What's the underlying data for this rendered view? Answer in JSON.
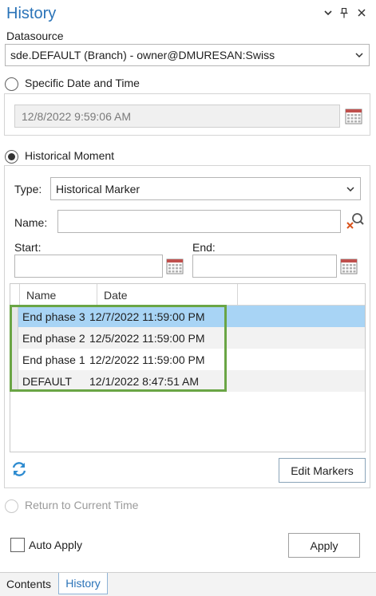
{
  "header": {
    "title": "History"
  },
  "datasource": {
    "label": "Datasource",
    "value": "sde.DEFAULT (Branch) - owner@DMURESAN:Swiss"
  },
  "specific": {
    "label": "Specific Date and Time",
    "value": "12/8/2022 9:59:06 AM",
    "selected": false
  },
  "historical": {
    "label": "Historical Moment",
    "selected": true,
    "type_label": "Type:",
    "type_value": "Historical Marker",
    "name_label": "Name:",
    "name_value": "",
    "start_label": "Start:",
    "end_label": "End:"
  },
  "table": {
    "columns": [
      "Name",
      "Date"
    ],
    "rows": [
      {
        "name": "End phase 3",
        "date": "12/7/2022 11:59:00 PM",
        "selected": true
      },
      {
        "name": "End phase 2",
        "date": "12/5/2022 11:59:00 PM",
        "selected": false
      },
      {
        "name": "End phase 1",
        "date": "12/2/2022 11:59:00 PM",
        "selected": false
      },
      {
        "name": "DEFAULT",
        "date": "12/1/2022 8:47:51 AM",
        "selected": false
      }
    ],
    "selected_row_color": "#a8d4f5",
    "alt_row_color": "#f2f2f2",
    "highlight_border_color": "#6aa545"
  },
  "actions": {
    "edit_markers": "Edit Markers",
    "return_current": "Return to Current Time",
    "auto_apply": "Auto Apply",
    "apply": "Apply"
  },
  "tabs": [
    {
      "label": "Contents",
      "active": false
    },
    {
      "label": "History",
      "active": true
    }
  ],
  "colors": {
    "accent": "#2a73b8",
    "refresh_icon": "#2e8bd0"
  }
}
